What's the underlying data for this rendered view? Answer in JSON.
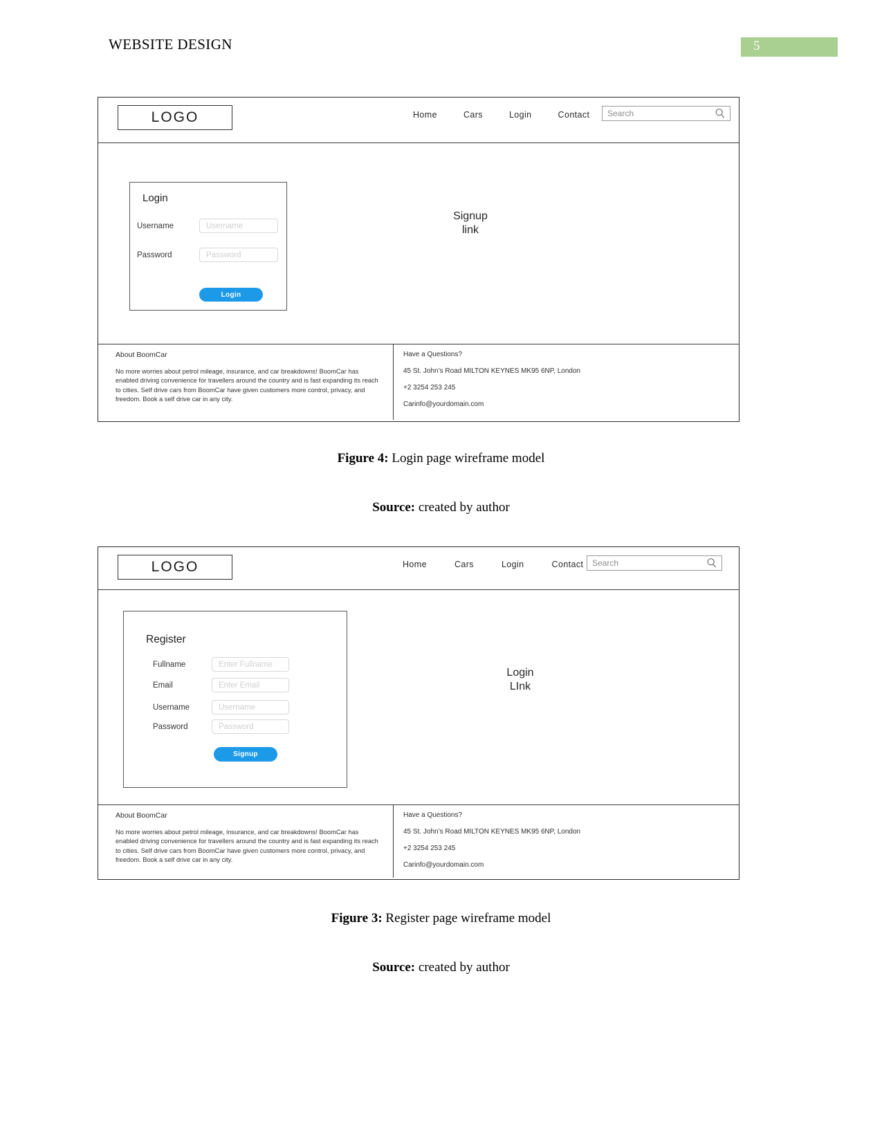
{
  "document": {
    "header_title": "WEBSITE DESIGN",
    "page_number": "5",
    "page_number_color": "#a9cf91"
  },
  "figures": [
    {
      "id": "login",
      "caption_label": "Figure 4:",
      "caption_text": " Login page wireframe model",
      "source_label": "Source:",
      "source_text": " created by author",
      "wireframe": {
        "logo": "LOGO",
        "nav": [
          "Home",
          "Cars",
          "Login",
          "Contact"
        ],
        "search": {
          "placeholder": "Search",
          "icon": "search-icon"
        },
        "panel": {
          "title": "Login",
          "fields": [
            {
              "label": "Username",
              "placeholder": "Username"
            },
            {
              "label": "Password",
              "placeholder": "Password"
            }
          ],
          "submit": "Login"
        },
        "side_link": "Signup\nlink",
        "footer": {
          "about_heading": "About BoomCar",
          "about_text": "No more worries about petrol mileage, insurance, and car breakdowns! BoomCar has enabled driving convenience for travellers around the country and is fast expanding its reach to cities. Self drive cars from BoomCar have given customers more control, privacy, and freedom. Book a self drive car in any city.",
          "contact_heading": "Have a Questions?",
          "contact_address": "45 St. John’s Road MILTON KEYNES MK95 6NP, London",
          "contact_phone": "+2 3254 253 245",
          "contact_email": "Carinfo@yourdomain.com"
        }
      }
    },
    {
      "id": "register",
      "caption_label": "Figure 3:",
      "caption_text": " Register page wireframe model",
      "source_label": "Source:",
      "source_text": " created by author",
      "wireframe": {
        "logo": "LOGO",
        "nav": [
          "Home",
          "Cars",
          "Login",
          "Contact"
        ],
        "search": {
          "placeholder": "Search",
          "icon": "search-icon"
        },
        "panel": {
          "title": "Register",
          "fields": [
            {
              "label": "Fullname",
              "placeholder": "Enter Fullname"
            },
            {
              "label": "Email",
              "placeholder": "Enter Email"
            },
            {
              "label": "Username",
              "placeholder": "Username"
            },
            {
              "label": "Password",
              "placeholder": "Password"
            }
          ],
          "submit": "Signup"
        },
        "side_link": "Login\nLInk",
        "footer": {
          "about_heading": "About BoomCar",
          "about_text": "No more worries about petrol mileage, insurance, and car breakdowns! BoomCar has enabled driving convenience for travellers around the country and is fast expanding its reach to cities. Self drive cars from BoomCar have given customers more control, privacy, and freedom. Book a self drive car in any city.",
          "contact_heading": "Have a Questions?",
          "contact_address": "45 St. John’s Road MILTON KEYNES MK95 6NP, London",
          "contact_phone": "+2 3254 253 245",
          "contact_email": "Carinfo@yourdomain.com"
        }
      }
    }
  ],
  "colors": {
    "button_blue": "#1c9ae8",
    "header_green": "#a9cf91"
  }
}
